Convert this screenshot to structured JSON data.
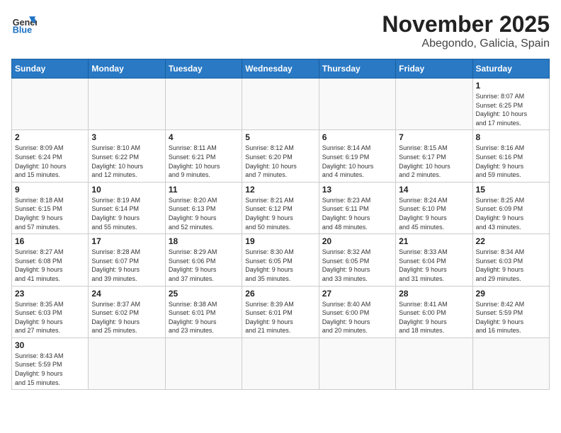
{
  "logo": {
    "line1": "General",
    "line2": "Blue"
  },
  "title": "November 2025",
  "location": "Abegondo, Galicia, Spain",
  "days_of_week": [
    "Sunday",
    "Monday",
    "Tuesday",
    "Wednesday",
    "Thursday",
    "Friday",
    "Saturday"
  ],
  "weeks": [
    [
      {
        "day": "",
        "info": ""
      },
      {
        "day": "",
        "info": ""
      },
      {
        "day": "",
        "info": ""
      },
      {
        "day": "",
        "info": ""
      },
      {
        "day": "",
        "info": ""
      },
      {
        "day": "",
        "info": ""
      },
      {
        "day": "1",
        "info": "Sunrise: 8:07 AM\nSunset: 6:25 PM\nDaylight: 10 hours\nand 17 minutes."
      }
    ],
    [
      {
        "day": "2",
        "info": "Sunrise: 8:09 AM\nSunset: 6:24 PM\nDaylight: 10 hours\nand 15 minutes."
      },
      {
        "day": "3",
        "info": "Sunrise: 8:10 AM\nSunset: 6:22 PM\nDaylight: 10 hours\nand 12 minutes."
      },
      {
        "day": "4",
        "info": "Sunrise: 8:11 AM\nSunset: 6:21 PM\nDaylight: 10 hours\nand 9 minutes."
      },
      {
        "day": "5",
        "info": "Sunrise: 8:12 AM\nSunset: 6:20 PM\nDaylight: 10 hours\nand 7 minutes."
      },
      {
        "day": "6",
        "info": "Sunrise: 8:14 AM\nSunset: 6:19 PM\nDaylight: 10 hours\nand 4 minutes."
      },
      {
        "day": "7",
        "info": "Sunrise: 8:15 AM\nSunset: 6:17 PM\nDaylight: 10 hours\nand 2 minutes."
      },
      {
        "day": "8",
        "info": "Sunrise: 8:16 AM\nSunset: 6:16 PM\nDaylight: 9 hours\nand 59 minutes."
      }
    ],
    [
      {
        "day": "9",
        "info": "Sunrise: 8:18 AM\nSunset: 6:15 PM\nDaylight: 9 hours\nand 57 minutes."
      },
      {
        "day": "10",
        "info": "Sunrise: 8:19 AM\nSunset: 6:14 PM\nDaylight: 9 hours\nand 55 minutes."
      },
      {
        "day": "11",
        "info": "Sunrise: 8:20 AM\nSunset: 6:13 PM\nDaylight: 9 hours\nand 52 minutes."
      },
      {
        "day": "12",
        "info": "Sunrise: 8:21 AM\nSunset: 6:12 PM\nDaylight: 9 hours\nand 50 minutes."
      },
      {
        "day": "13",
        "info": "Sunrise: 8:23 AM\nSunset: 6:11 PM\nDaylight: 9 hours\nand 48 minutes."
      },
      {
        "day": "14",
        "info": "Sunrise: 8:24 AM\nSunset: 6:10 PM\nDaylight: 9 hours\nand 45 minutes."
      },
      {
        "day": "15",
        "info": "Sunrise: 8:25 AM\nSunset: 6:09 PM\nDaylight: 9 hours\nand 43 minutes."
      }
    ],
    [
      {
        "day": "16",
        "info": "Sunrise: 8:27 AM\nSunset: 6:08 PM\nDaylight: 9 hours\nand 41 minutes."
      },
      {
        "day": "17",
        "info": "Sunrise: 8:28 AM\nSunset: 6:07 PM\nDaylight: 9 hours\nand 39 minutes."
      },
      {
        "day": "18",
        "info": "Sunrise: 8:29 AM\nSunset: 6:06 PM\nDaylight: 9 hours\nand 37 minutes."
      },
      {
        "day": "19",
        "info": "Sunrise: 8:30 AM\nSunset: 6:05 PM\nDaylight: 9 hours\nand 35 minutes."
      },
      {
        "day": "20",
        "info": "Sunrise: 8:32 AM\nSunset: 6:05 PM\nDaylight: 9 hours\nand 33 minutes."
      },
      {
        "day": "21",
        "info": "Sunrise: 8:33 AM\nSunset: 6:04 PM\nDaylight: 9 hours\nand 31 minutes."
      },
      {
        "day": "22",
        "info": "Sunrise: 8:34 AM\nSunset: 6:03 PM\nDaylight: 9 hours\nand 29 minutes."
      }
    ],
    [
      {
        "day": "23",
        "info": "Sunrise: 8:35 AM\nSunset: 6:03 PM\nDaylight: 9 hours\nand 27 minutes."
      },
      {
        "day": "24",
        "info": "Sunrise: 8:37 AM\nSunset: 6:02 PM\nDaylight: 9 hours\nand 25 minutes."
      },
      {
        "day": "25",
        "info": "Sunrise: 8:38 AM\nSunset: 6:01 PM\nDaylight: 9 hours\nand 23 minutes."
      },
      {
        "day": "26",
        "info": "Sunrise: 8:39 AM\nSunset: 6:01 PM\nDaylight: 9 hours\nand 21 minutes."
      },
      {
        "day": "27",
        "info": "Sunrise: 8:40 AM\nSunset: 6:00 PM\nDaylight: 9 hours\nand 20 minutes."
      },
      {
        "day": "28",
        "info": "Sunrise: 8:41 AM\nSunset: 6:00 PM\nDaylight: 9 hours\nand 18 minutes."
      },
      {
        "day": "29",
        "info": "Sunrise: 8:42 AM\nSunset: 5:59 PM\nDaylight: 9 hours\nand 16 minutes."
      }
    ],
    [
      {
        "day": "30",
        "info": "Sunrise: 8:43 AM\nSunset: 5:59 PM\nDaylight: 9 hours\nand 15 minutes."
      },
      {
        "day": "",
        "info": ""
      },
      {
        "day": "",
        "info": ""
      },
      {
        "day": "",
        "info": ""
      },
      {
        "day": "",
        "info": ""
      },
      {
        "day": "",
        "info": ""
      },
      {
        "day": "",
        "info": ""
      }
    ]
  ]
}
